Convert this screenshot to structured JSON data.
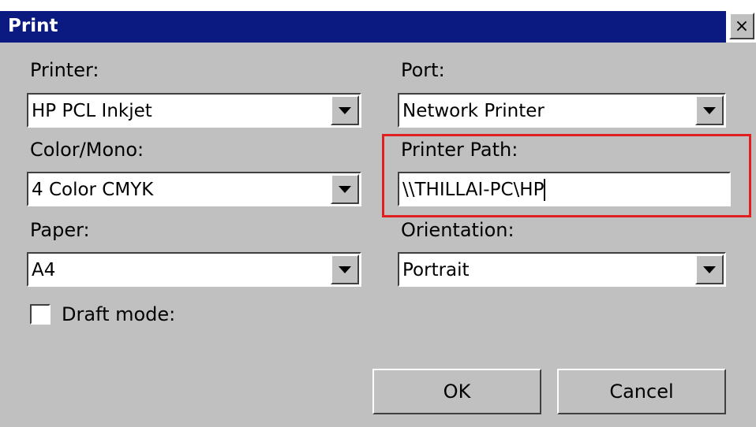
{
  "window": {
    "title": "Print",
    "close_symbol": "×"
  },
  "printer": {
    "label": "Printer:",
    "value": "HP PCL Inkjet"
  },
  "port": {
    "label": "Port:",
    "value": "Network Printer"
  },
  "color_mono": {
    "label": "Color/Mono:",
    "value": "4 Color CMYK"
  },
  "printer_path": {
    "label": "Printer Path:",
    "value": "\\\\THILLAI-PC\\HP"
  },
  "paper": {
    "label": "Paper:",
    "value": "A4"
  },
  "orientation": {
    "label": "Orientation:",
    "value": "Portrait"
  },
  "draft_mode": {
    "label": "Draft mode:",
    "checked": false
  },
  "buttons": {
    "ok": "OK",
    "cancel": "Cancel"
  },
  "colors": {
    "titlebar": "#0a1a80",
    "dialog_bg": "#c0c0c0",
    "highlight": "#e02020"
  },
  "icons": {
    "close": "close-icon",
    "dropdown": "chevron-down-icon"
  }
}
